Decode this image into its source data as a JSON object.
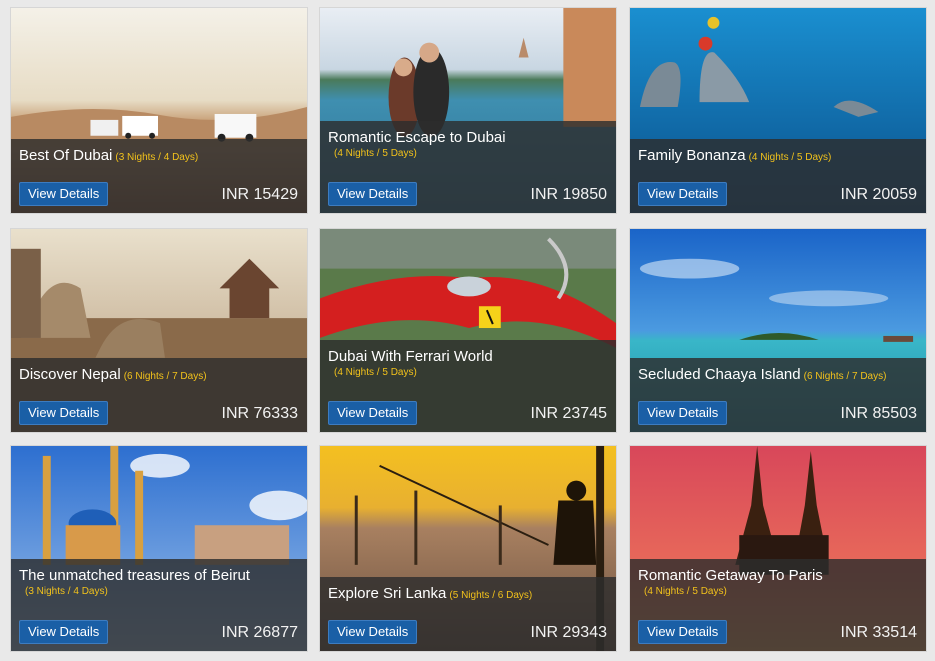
{
  "cards": [
    {
      "title": "Best Of Dubai",
      "duration": "(3 Nights / 4 Days)",
      "button": "View Details",
      "price": "INR 15429"
    },
    {
      "title": "Romantic Escape to Dubai",
      "duration": "(4 Nights / 5 Days)",
      "button": "View Details",
      "price": "INR 19850"
    },
    {
      "title": "Family Bonanza",
      "duration": "(4 Nights / 5 Days)",
      "button": "View Details",
      "price": "INR 20059"
    },
    {
      "title": "Discover Nepal",
      "duration": "(6 Nights / 7 Days)",
      "button": "View Details",
      "price": "INR 76333"
    },
    {
      "title": "Dubai With Ferrari World",
      "duration": "(4 Nights / 5 Days)",
      "button": "View Details",
      "price": "INR 23745"
    },
    {
      "title": "Secluded Chaaya Island",
      "duration": "(6 Nights / 7 Days)",
      "button": "View Details",
      "price": "INR 85503"
    },
    {
      "title": "The unmatched treasures of Beirut",
      "duration": "(3 Nights / 4 Days)",
      "button": "View Details",
      "price": "INR 26877"
    },
    {
      "title": "Explore Sri Lanka",
      "duration": "(5 Nights / 6 Days)",
      "button": "View Details",
      "price": "INR 29343"
    },
    {
      "title": "Romantic Getaway To Paris",
      "duration": "(4 Nights / 5 Days)",
      "button": "View Details",
      "price": "INR 33514"
    }
  ]
}
